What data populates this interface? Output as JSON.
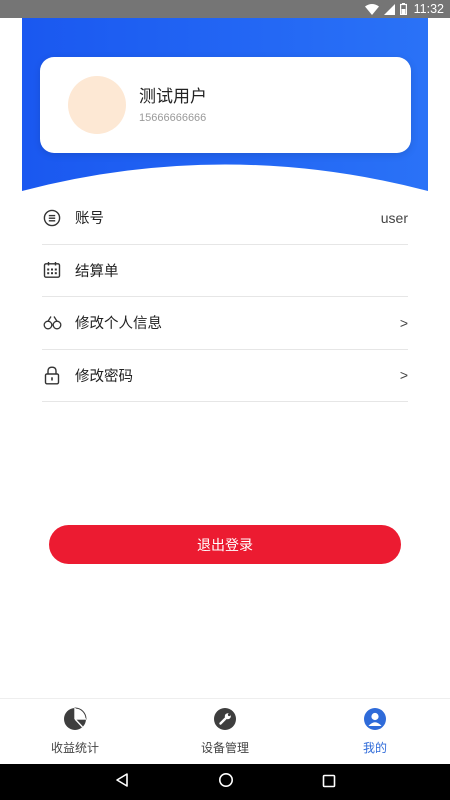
{
  "status_bar": {
    "time": "11:32"
  },
  "profile": {
    "name": "测试用户",
    "phone": "15666666666"
  },
  "menu": {
    "items": [
      {
        "label": "账号",
        "right": "user",
        "icon": "account-icon"
      },
      {
        "label": "结算单",
        "right": "",
        "icon": "calendar-icon"
      },
      {
        "label": "修改个人信息",
        "right": ">",
        "icon": "edit-profile-icon"
      },
      {
        "label": "修改密码",
        "right": ">",
        "icon": "lock-icon"
      }
    ]
  },
  "logout_label": "退出登录",
  "tabs": [
    {
      "label": "收益统计",
      "icon": "pie-chart-icon",
      "active": false
    },
    {
      "label": "设备管理",
      "icon": "wrench-icon",
      "active": false
    },
    {
      "label": "我的",
      "icon": "user-icon",
      "active": true
    }
  ],
  "colors": {
    "banner_blue": "#1e5ff2",
    "logout_red": "#ec1b31",
    "active_tab": "#2f6bd9",
    "avatar_bg": "#fde8d4"
  }
}
